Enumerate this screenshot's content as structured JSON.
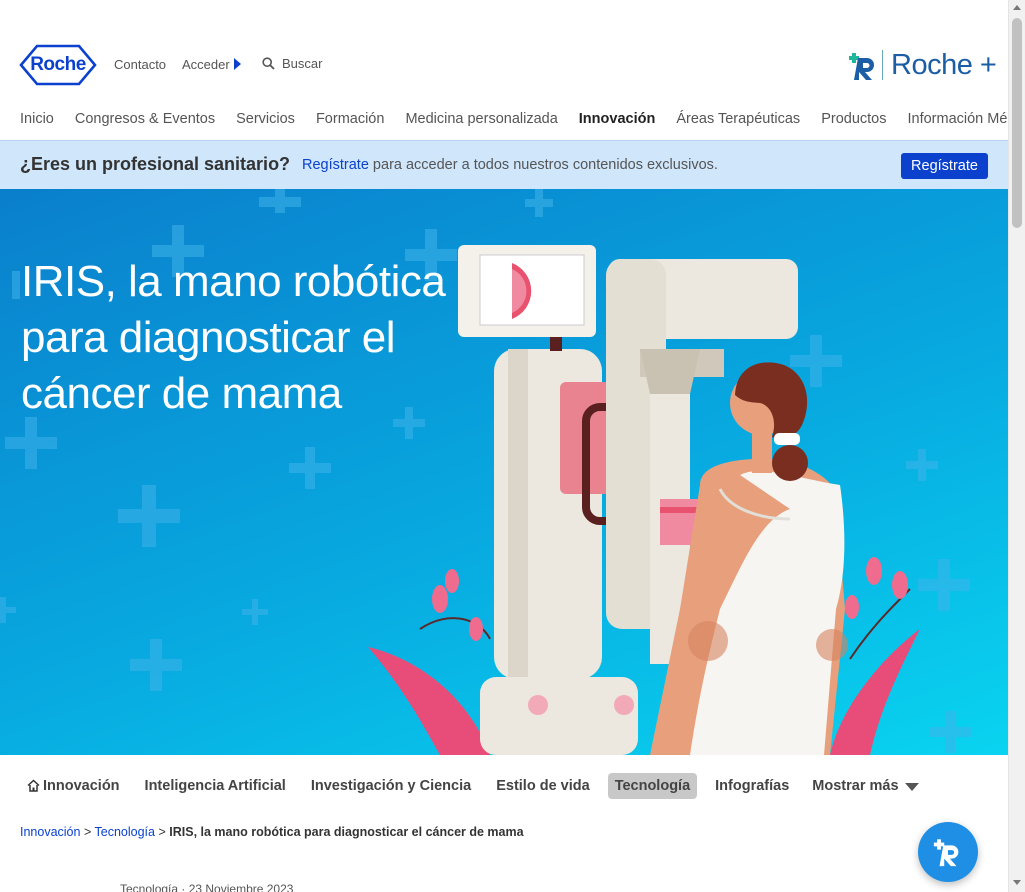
{
  "header": {
    "logo_text": "Roche",
    "contact_label": "Contacto",
    "login_label": "Acceder",
    "search_placeholder": "Buscar",
    "brand_plus_text": "Roche +"
  },
  "nav": {
    "items": [
      {
        "label": "Inicio"
      },
      {
        "label": "Congresos & Eventos"
      },
      {
        "label": "Servicios"
      },
      {
        "label": "Formación"
      },
      {
        "label": "Medicina personalizada"
      },
      {
        "label": "Innovación",
        "active": true
      },
      {
        "label": "Áreas Terapéuticas"
      },
      {
        "label": "Productos"
      },
      {
        "label": "Información Médica"
      }
    ]
  },
  "promo": {
    "question": "¿Eres un profesional sanitario?",
    "link_text": "Regístrate",
    "text_rest": " para acceder a todos nuestros contenidos exclusivos.",
    "button_label": "Regístrate"
  },
  "hero": {
    "title": "IRIS, la mano robótica para diagnosticar el cáncer de mama"
  },
  "categories": {
    "items": [
      {
        "label": "Innovación",
        "icon": "home-icon"
      },
      {
        "label": "Inteligencia Artificial"
      },
      {
        "label": "Investigación y Ciencia"
      },
      {
        "label": "Estilo de vida"
      },
      {
        "label": "Tecnología",
        "active": true
      },
      {
        "label": "Infografías"
      }
    ],
    "more_label": "Mostrar más"
  },
  "breadcrumb": {
    "items": [
      "Innovación",
      "Tecnología"
    ],
    "separator": ">",
    "current": "IRIS, la mano robótica para diagnosticar el cáncer de mama"
  },
  "article_meta": {
    "text": "Tecnología · 23 Noviembre 2023"
  },
  "colors": {
    "brand_blue": "#0b41cd",
    "promo_bg": "#cfe6fb",
    "hero_blue": "#0a7fcc",
    "hero_cyan": "#09d4f0",
    "fab_blue": "#1f8fe6"
  }
}
